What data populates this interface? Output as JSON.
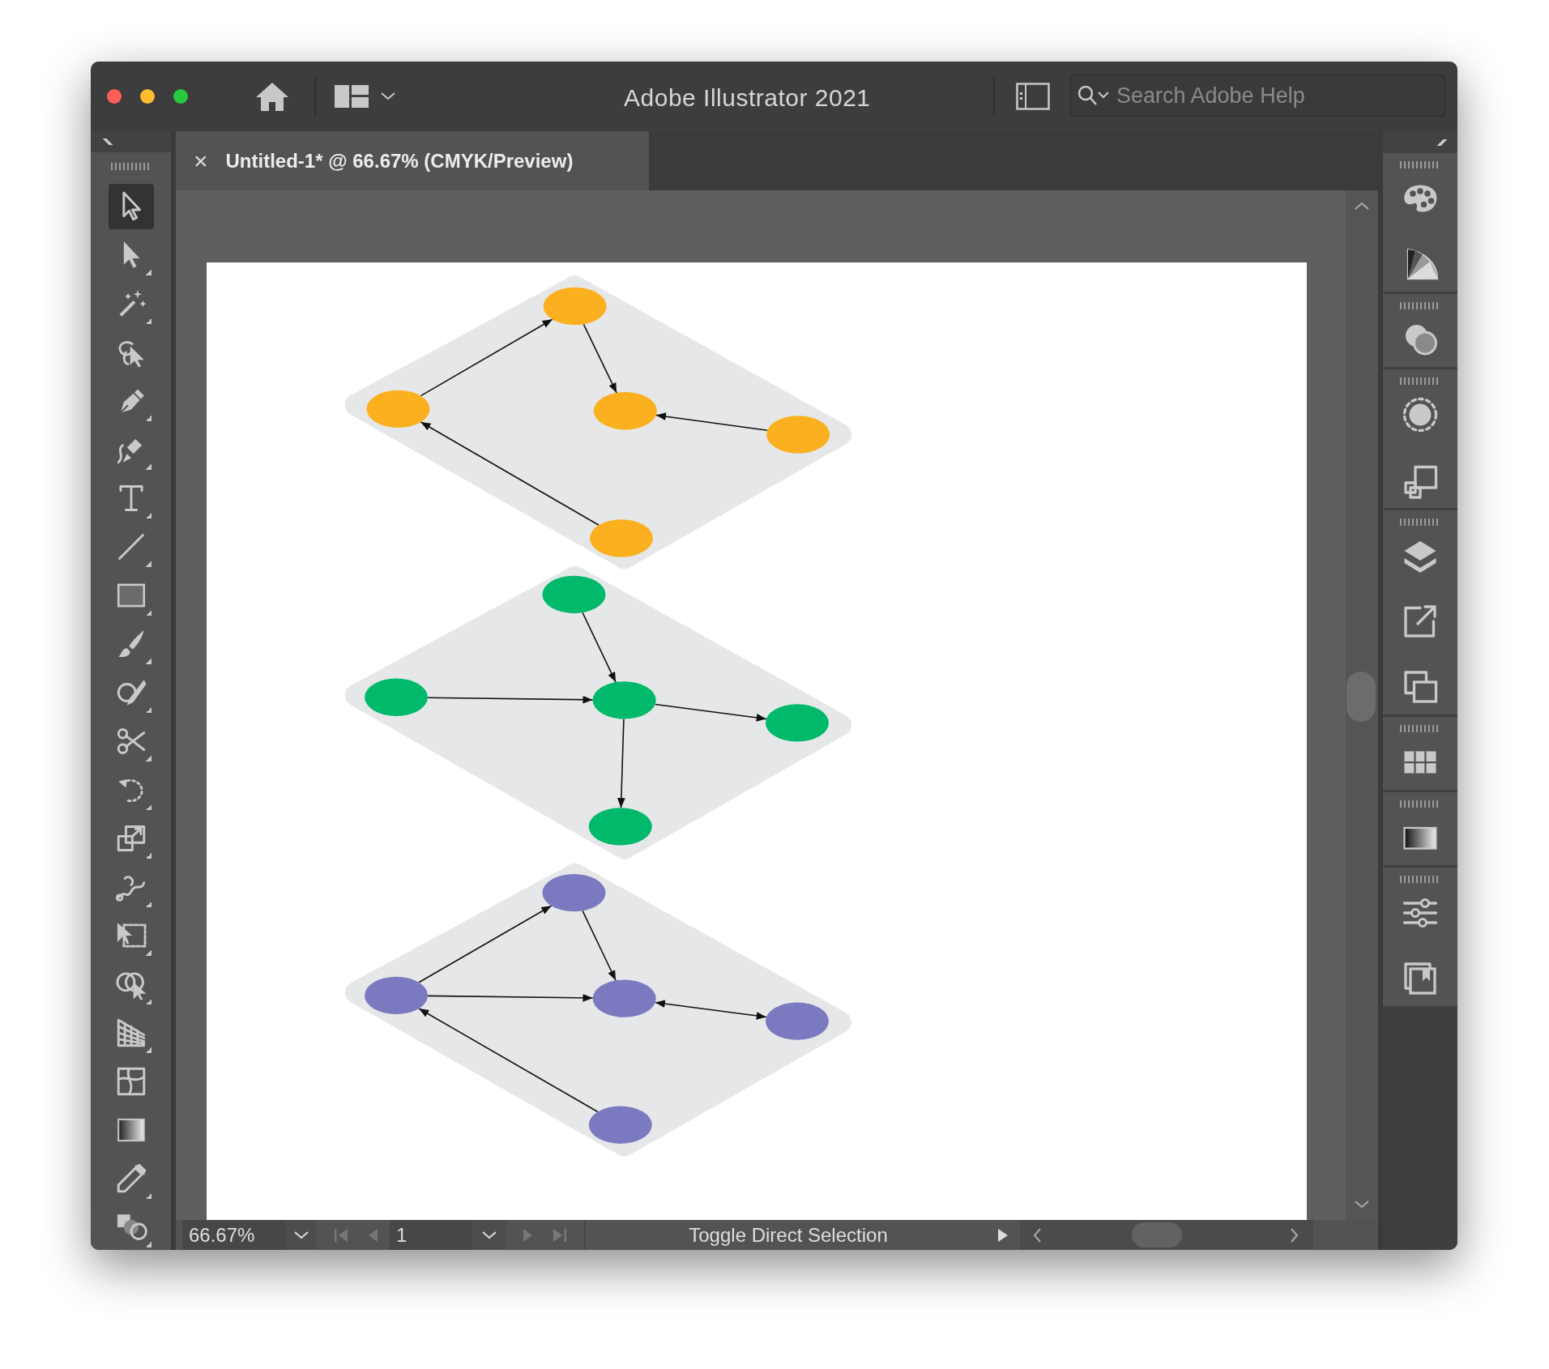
{
  "window": {
    "title": "Adobe Illustrator 2021"
  },
  "search": {
    "placeholder": "Search Adobe Help"
  },
  "document_tab": {
    "label": "Untitled-1* @ 66.67% (CMYK/Preview)",
    "close": "×"
  },
  "tools": [
    {
      "selected": true
    },
    {
      "selected": false
    },
    {
      "selected": false
    },
    {
      "selected": false
    },
    {
      "selected": false
    },
    {
      "selected": false
    },
    {
      "selected": false
    },
    {
      "selected": false
    },
    {
      "selected": false
    },
    {
      "selected": false
    },
    {
      "selected": false
    },
    {
      "selected": false
    },
    {
      "selected": false
    },
    {
      "selected": false
    },
    {
      "selected": false
    },
    {
      "selected": false
    },
    {
      "selected": false
    },
    {
      "selected": false
    },
    {
      "selected": false
    },
    {
      "selected": false
    },
    {
      "selected": false
    },
    {
      "selected": false
    }
  ],
  "graphs": [
    {
      "color": "#fbb01f"
    },
    {
      "color": "#00b96b"
    },
    {
      "color": "#7b79c0"
    }
  ],
  "status_bar": {
    "zoom": "66.67%",
    "artboard": "1",
    "message": "Toggle Direct Selection"
  }
}
